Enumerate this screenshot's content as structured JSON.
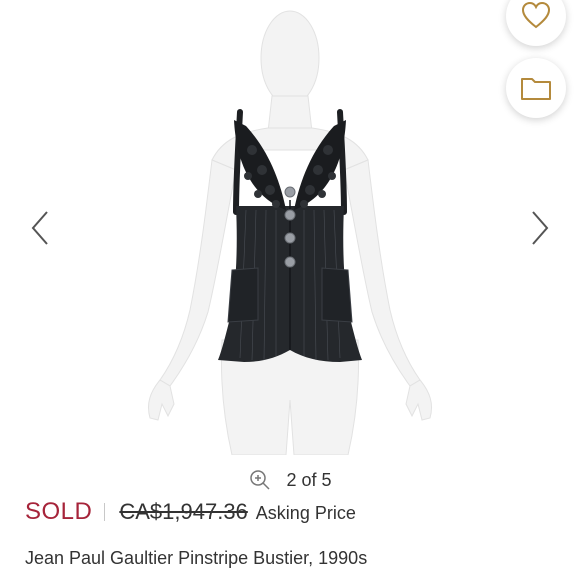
{
  "gallery": {
    "counter": "2 of 5",
    "prev_label": "Previous image",
    "next_label": "Next image",
    "zoom_label": "Zoom image",
    "image_alt": "Black pinstripe bustier with crochet cups on a white mannequin"
  },
  "actions": {
    "heart_icon": "heart-outline-icon",
    "folder_icon": "folder-icon",
    "accent_color": "#b48a3c"
  },
  "listing": {
    "status": "SOLD",
    "original_price": "CA$1,947.36",
    "price_caption": "Asking Price",
    "title": "Jean Paul Gaultier Pinstripe Bustier, 1990s",
    "status_color": "#a6243a"
  }
}
